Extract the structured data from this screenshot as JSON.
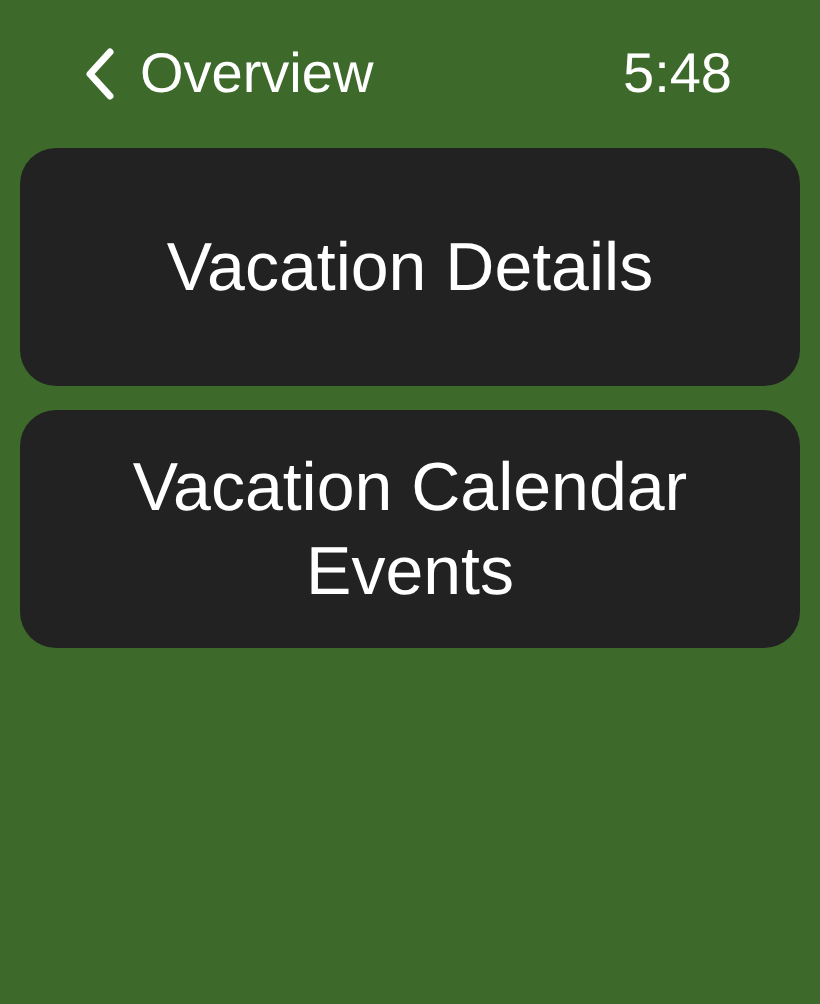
{
  "header": {
    "back_label": "Overview",
    "time": "5:48"
  },
  "buttons": [
    {
      "label": "Vacation Details"
    },
    {
      "label": "Vacation Calendar Events"
    }
  ]
}
